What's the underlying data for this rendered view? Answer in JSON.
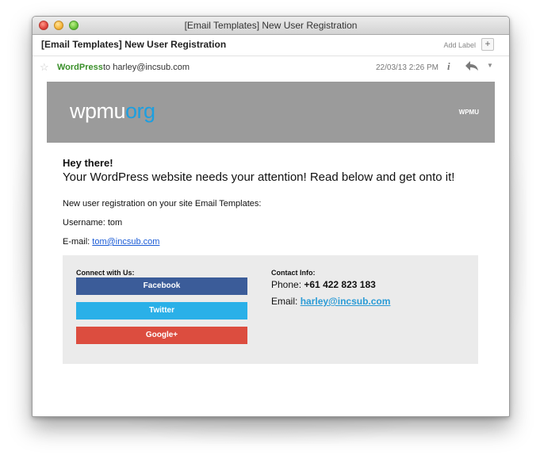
{
  "window": {
    "title": "[Email Templates] New User Registration"
  },
  "message_header": {
    "subject": "[Email Templates] New User Registration",
    "add_label": "Add Label",
    "add_label_button": "+",
    "sender_name": "WordPress",
    "to_text": " to harley@incsub.com",
    "date": "22/03/13 2:26 PM",
    "info_icon": "i",
    "reply_icon": "←",
    "more_icon": "▼"
  },
  "email": {
    "logo_main": "wpmu",
    "logo_accent": "org",
    "logo_right": "WPMU",
    "greeting": "Hey there!",
    "headline": "Your WordPress website needs your attention! Read below and get onto it!",
    "registration_line": "New user registration on your site Email Templates:",
    "username_line": "Username: tom",
    "email_label": "E-mail: ",
    "email_value": "tom@incsub.com"
  },
  "footer": {
    "connect_title": "Connect with Us:",
    "facebook": "Facebook",
    "twitter": "Twitter",
    "googleplus": "Google+",
    "contact_title": "Contact Info:",
    "phone_label": "Phone: ",
    "phone_value": "+61 422 823 183",
    "email_label": "Email: ",
    "email_value": "harley@incsub.com"
  },
  "colors": {
    "sender_green": "#3a8f2a",
    "logo_accent_blue": "#1d9fe0",
    "facebook": "#3b5c99",
    "twitter": "#2ab0e8",
    "googleplus": "#dc4d3f",
    "link_blue": "#1a5bd6"
  }
}
